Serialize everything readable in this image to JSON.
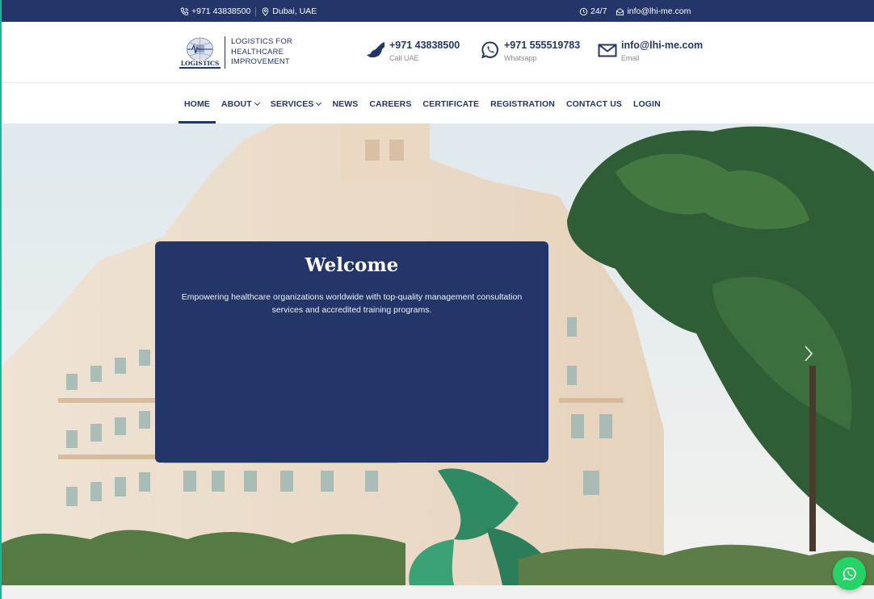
{
  "topbar": {
    "phone": "+971 43838500",
    "location": "Dubai, UAE",
    "hours": "24/7",
    "email": "info@lhi-me.com"
  },
  "logo": {
    "line1_cap": "L",
    "line1_rest": "OGISTICS FOR",
    "line2_cap": "H",
    "line2_rest": "EALTHCARE",
    "line3_cap": "I",
    "line3_rest": "MPROVEMENT",
    "mark_text": "LOGISTICS"
  },
  "contacts": {
    "uae": {
      "value": "+971 43838500",
      "label": "Call UAE",
      "icon": "uae-map-icon"
    },
    "whatsapp": {
      "value": "+971 555519783",
      "label": "Whatsapp",
      "icon": "whatsapp-icon"
    },
    "email": {
      "value": "info@lhi-me.com",
      "label": "Email",
      "icon": "envelope-icon"
    }
  },
  "nav": {
    "items": [
      {
        "label": "HOME",
        "active": true
      },
      {
        "label": "ABOUT",
        "dropdown": true
      },
      {
        "label": "SERVICES",
        "dropdown": true
      },
      {
        "label": "NEWS"
      },
      {
        "label": "CAREERS"
      },
      {
        "label": "CERTIFICATE"
      },
      {
        "label": "REGISTRATION"
      },
      {
        "label": "CONTACT US"
      },
      {
        "label": "LOGIN"
      }
    ]
  },
  "hero": {
    "title": "Welcome",
    "body": "Empowering healthcare organizations worldwide with top-quality management consultation services and accredited training programs.",
    "next_icon": "chevron-right-icon"
  },
  "colors": {
    "brand_navy": "#243669",
    "accent_teal": "#1fb39a",
    "whatsapp_green": "#25d366"
  }
}
